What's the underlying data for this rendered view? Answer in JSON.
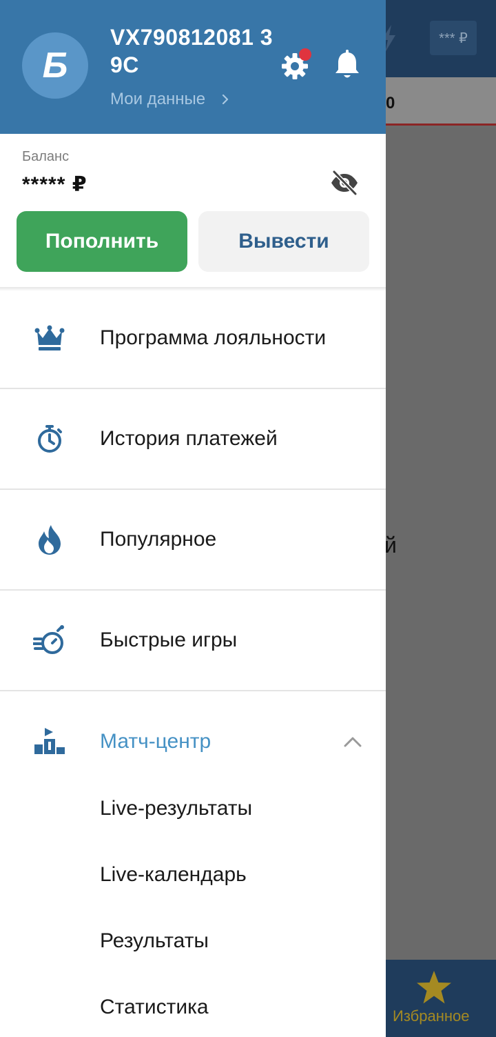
{
  "background": {
    "balance_masked": "*** ₽",
    "tab_fragment": "0",
    "body_fragment": "й",
    "favorites_label": "Избранное"
  },
  "drawer": {
    "avatar_letter": "Б",
    "user_id": "VX790812081 39C",
    "my_data_link": "Мои данные",
    "has_notification": true,
    "balance_label": "Баланс",
    "balance_value": "***** ₽",
    "deposit_button": "Пополнить",
    "withdraw_button": "Вывести",
    "menu": [
      {
        "label": "Программа лояльности",
        "icon": "crown-icon"
      },
      {
        "label": "История платежей",
        "icon": "stopwatch-icon"
      },
      {
        "label": "Популярное",
        "icon": "flame-icon"
      },
      {
        "label": "Быстрые игры",
        "icon": "fast-stopwatch-icon"
      },
      {
        "label": "Матч-центр",
        "icon": "podium-icon",
        "expanded": true
      }
    ],
    "submenu": [
      {
        "label": "Live-результаты"
      },
      {
        "label": "Live-календарь"
      },
      {
        "label": "Результаты"
      },
      {
        "label": "Статистика"
      }
    ]
  },
  "colors": {
    "header_blue": "#3876a8",
    "deposit_green": "#3fa45a",
    "accent_blue": "#4591c4",
    "icon_blue": "#2f6a9c",
    "notification_red": "#e0343f"
  }
}
